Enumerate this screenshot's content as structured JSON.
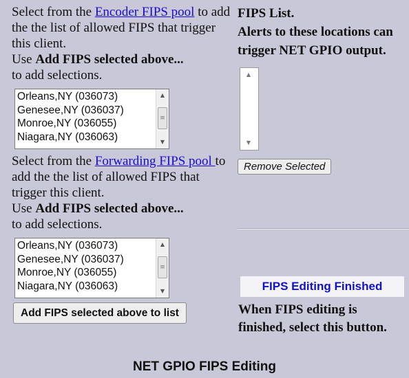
{
  "encoder": {
    "text_before": "Select from the ",
    "link": "Encoder FIPS pool",
    "text_after": " to add the the list of allowed FIPS that trigger this client.",
    "use_prefix": "Use ",
    "use_bold": "Add FIPS selected above...",
    "use_suffix": "to add selections.",
    "options": [
      "Orleans,NY (036073)",
      "Genesee,NY (036037)",
      "Monroe,NY (036055)",
      "Niagara,NY (036063)"
    ]
  },
  "forwarding": {
    "text_before": "Select from the ",
    "link": "Forwarding FIPS pool ",
    "text_after": "to add the the list of allowed FIPS that trigger this client.",
    "use_prefix": "Use ",
    "use_bold": "Add FIPS selected above...",
    "use_suffix": "to add selections.",
    "options": [
      "Orleans,NY (036073)",
      "Genesee,NY (036037)",
      "Monroe,NY (036055)",
      "Niagara,NY (036063)"
    ]
  },
  "add_button": "Add FIPS selected above to list",
  "fips_list": {
    "heading": "FIPS List.",
    "description": "Alerts to these locations can trigger NET GPIO output.",
    "remove_button": "Remove Selected"
  },
  "finished": {
    "button": "FIPS Editing Finished",
    "text": "When FIPS editing is finished, select this button."
  },
  "footer_title": "NET GPIO FIPS Editing",
  "colors": {
    "background": "#c9c8d8",
    "link": "#1a0dcc",
    "finished_button_text": "#1212c8"
  },
  "icons": {
    "scroll_up": "triangle-up",
    "scroll_down": "triangle-down",
    "scroll_thumb": "grip-lines"
  }
}
